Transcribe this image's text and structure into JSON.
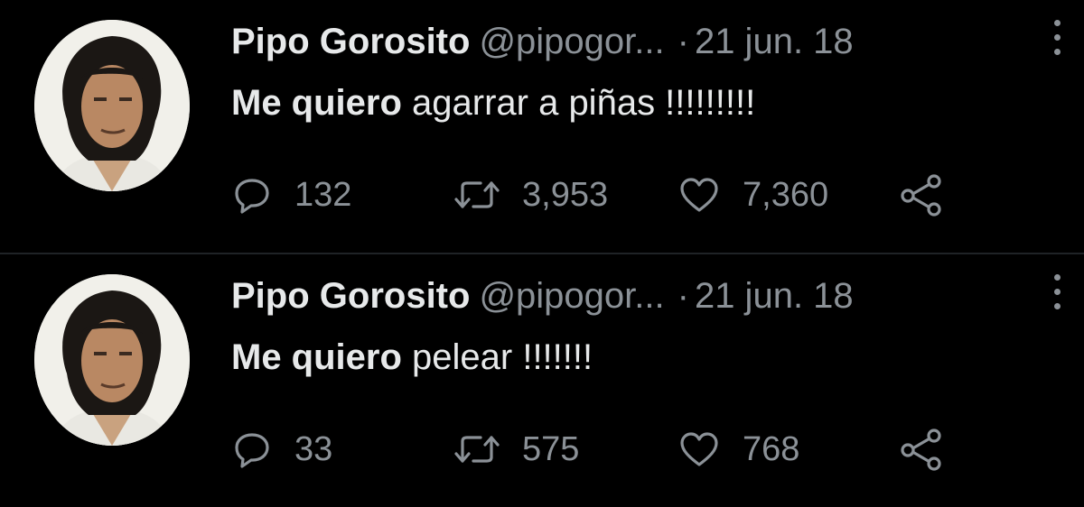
{
  "colors": {
    "background": "#000000",
    "primary_text": "#e7e9ea",
    "secondary_text": "#8b9197",
    "divider": "#1f2326"
  },
  "tweets": [
    {
      "author_name": "Pipo Gorosito",
      "handle": "@pipogor...",
      "separator": "·",
      "date": "21 jun. 18",
      "text_bold": "Me quiero",
      "text_rest": " agarrar a piñas !!!!!!!!!",
      "replies": "132",
      "retweets": "3,953",
      "likes": "7,360",
      "icons": [
        "reply-icon",
        "retweet-icon",
        "like-icon",
        "share-icon",
        "more-icon"
      ]
    },
    {
      "author_name": "Pipo Gorosito",
      "handle": "@pipogor...",
      "separator": "·",
      "date": "21 jun. 18",
      "text_bold": "Me quiero",
      "text_rest": " pelear !!!!!!!",
      "replies": "33",
      "retweets": "575",
      "likes": "768",
      "icons": [
        "reply-icon",
        "retweet-icon",
        "like-icon",
        "share-icon",
        "more-icon"
      ]
    }
  ]
}
